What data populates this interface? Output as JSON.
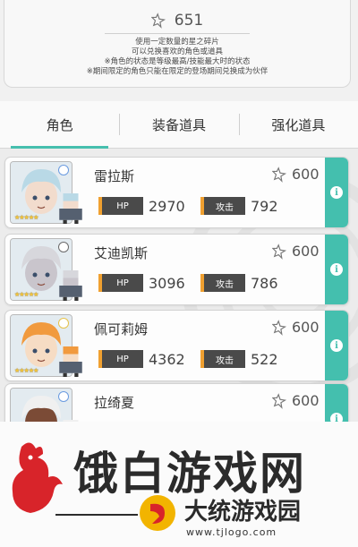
{
  "shards": {
    "icon": "star-shard-icon",
    "count": "651",
    "lines": [
      "使用一定数量的星之碎片",
      "可以兑换喜欢的角色或道具",
      "※角色的状态是等级最高/技能最大时的状态",
      "※期间限定的角色只能在限定的登场期间兑换成为伙伴"
    ]
  },
  "tabs": [
    {
      "label": "角色",
      "active": true
    },
    {
      "label": "装备道具",
      "active": false
    },
    {
      "label": "强化道具",
      "active": false
    }
  ],
  "stat_labels": {
    "hp": "HP",
    "atk": "攻击"
  },
  "characters": [
    {
      "name": "雷拉斯",
      "cost": "600",
      "hp": "2970",
      "atk": "792",
      "stars": "★★★★★",
      "hair": "#b9d9e6",
      "skin": "#f2dccd",
      "element": "#6a9be0"
    },
    {
      "name": "艾迪凯斯",
      "cost": "600",
      "hp": "3096",
      "atk": "786",
      "stars": "★★★★★",
      "hair": "#d7d7dc",
      "skin": "#c9c5cc",
      "element": "#6b6b6b"
    },
    {
      "name": "佩可莉姆",
      "cost": "600",
      "hp": "4362",
      "atk": "522",
      "stars": "★★★★★",
      "hair": "#f19a3e",
      "skin": "#f6dcc4",
      "element": "#e6c24b"
    },
    {
      "name": "拉绮夏",
      "cost": "600",
      "hp": "",
      "atk": "",
      "stars": "",
      "hair": "#f0f0f0",
      "skin": "#7b4b36",
      "element": "#6a9be0"
    }
  ],
  "watermark": {
    "title": "饿白游戏网",
    "subtitle": "大统游戏园",
    "url": "www.tjlogo.com"
  },
  "colors": {
    "accent": "#44bfae",
    "stat_accent": "#f0a030"
  }
}
